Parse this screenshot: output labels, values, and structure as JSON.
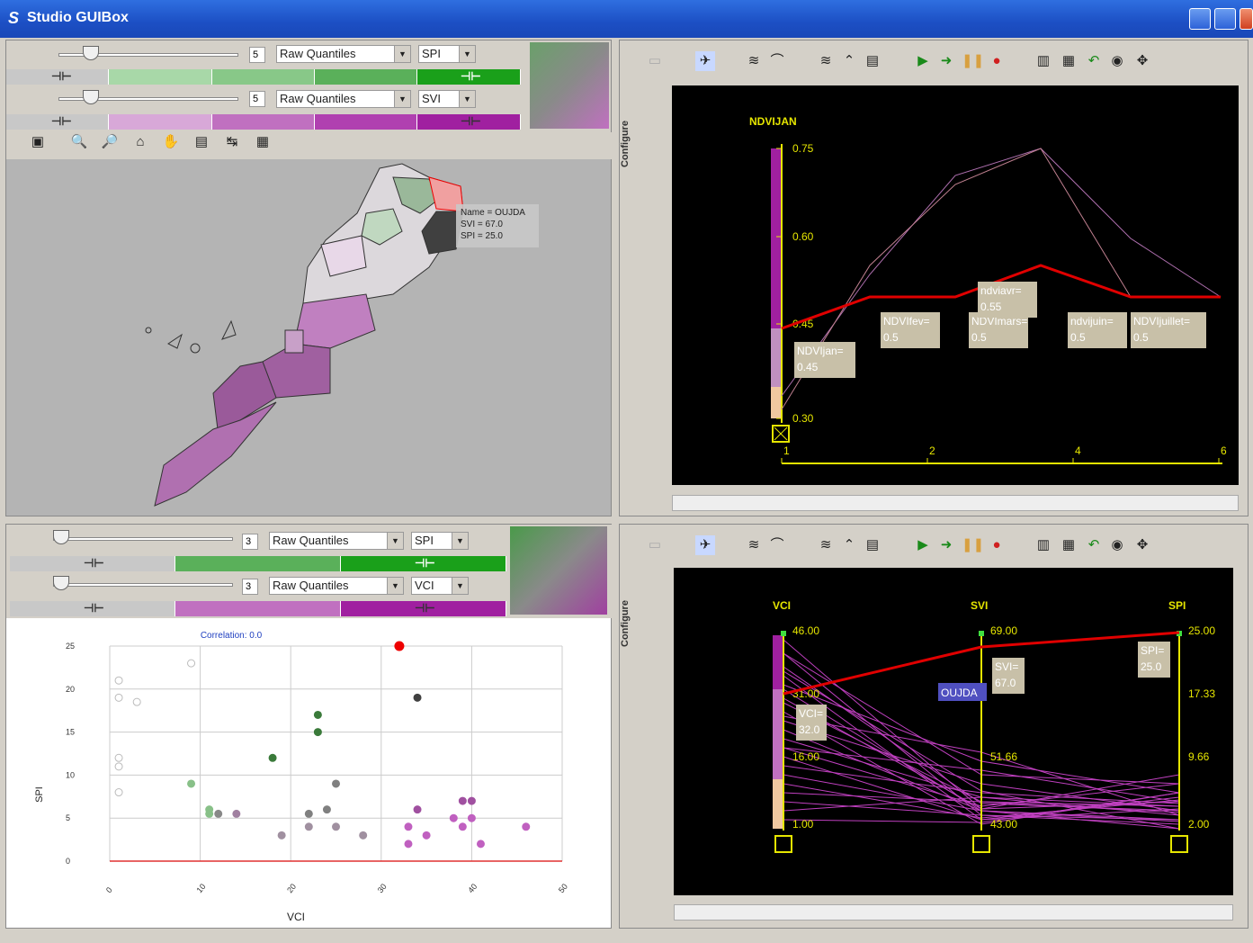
{
  "window": {
    "title": "Studio GUIBox",
    "logo": "S"
  },
  "top_left": {
    "row1": {
      "classes": "5",
      "method": "Raw Quantiles",
      "variable": "SPI"
    },
    "row2": {
      "classes": "5",
      "method": "Raw Quantiles",
      "variable": "SVI"
    },
    "tooltip": {
      "name": "Name = OUJDA",
      "svi": "SVI = 67.0",
      "spi": "SPI = 25.0"
    }
  },
  "bottom_left": {
    "row1": {
      "classes": "3",
      "method": "Raw Quantiles",
      "variable": "SPI"
    },
    "row2": {
      "classes": "3",
      "method": "Raw Quantiles",
      "variable": "VCI"
    },
    "chart_title": "Correlation: 0.0"
  },
  "top_right": {
    "configure": "Configure",
    "axis_title": "NDVIJAN",
    "y_ticks": [
      "0.75",
      "0.60",
      "0.45",
      "0.30"
    ],
    "x_ticks": [
      "1",
      "2",
      "4",
      "6"
    ],
    "labels": [
      {
        "k": "NDVIjan=",
        "v": "0.45"
      },
      {
        "k": "NDVIfev=",
        "v": "0.5"
      },
      {
        "k": "NDVImars=",
        "v": "0.5"
      },
      {
        "k": "ndviavr=",
        "v": "0.55"
      },
      {
        "k": "ndvijuin=",
        "v": "0.5"
      },
      {
        "k": "NDVIjuillet=",
        "v": "0.5"
      }
    ]
  },
  "bottom_right": {
    "configure": "Configure",
    "axes": [
      {
        "name": "VCI",
        "ticks": [
          "46.00",
          "31.00",
          "16.00",
          "1.00"
        ]
      },
      {
        "name": "SVI",
        "ticks": [
          "69.00",
          "51.66",
          "43.00"
        ]
      },
      {
        "name": "SPI",
        "ticks": [
          "25.00",
          "17.33",
          "9.66",
          "2.00"
        ]
      }
    ],
    "labels": {
      "vci": {
        "k": "VCI=",
        "v": "32.0"
      },
      "svi": {
        "k": "SVI=",
        "v": "67.0"
      },
      "spi": {
        "k": "SPI=",
        "v": "25.0"
      },
      "name": "OUJDA"
    }
  },
  "colors": {
    "green": "#1aa01a",
    "purple": "#a020a0",
    "red": "#e00000",
    "yellow": "#e6e600"
  },
  "chart_data": {
    "type": "scatter",
    "title": "Correlation: 0.0",
    "xlabel": "VCI",
    "ylabel": "SPI",
    "xlim": [
      0,
      50
    ],
    "ylim": [
      0,
      25
    ],
    "x_ticks": [
      "0",
      "10",
      "20",
      "30",
      "40",
      "50"
    ],
    "y_ticks": [
      "25",
      "20",
      "15",
      "10",
      "5",
      "0"
    ],
    "points": [
      {
        "x": 1,
        "y": 21,
        "c": "#cccccc",
        "h": true
      },
      {
        "x": 1,
        "y": 19,
        "c": "#cccccc",
        "h": true
      },
      {
        "x": 3,
        "y": 18.5,
        "c": "#cccccc",
        "h": true
      },
      {
        "x": 1,
        "y": 12,
        "c": "#cccccc",
        "h": true
      },
      {
        "x": 1,
        "y": 11,
        "c": "#cccccc",
        "h": true
      },
      {
        "x": 1,
        "y": 8,
        "c": "#cccccc",
        "h": true
      },
      {
        "x": 9,
        "y": 23,
        "c": "#cccccc",
        "h": true
      },
      {
        "x": 9,
        "y": 9,
        "c": "#88c088"
      },
      {
        "x": 11,
        "y": 6,
        "c": "#88c088"
      },
      {
        "x": 11,
        "y": 5.5,
        "c": "#88c088"
      },
      {
        "x": 12,
        "y": 5.5,
        "c": "#888888"
      },
      {
        "x": 14,
        "y": 5.5,
        "c": "#a080a0"
      },
      {
        "x": 18,
        "y": 12,
        "c": "#3a7a3a"
      },
      {
        "x": 23,
        "y": 17,
        "c": "#3a7a3a"
      },
      {
        "x": 23,
        "y": 15,
        "c": "#3a7a3a"
      },
      {
        "x": 19,
        "y": 3,
        "c": "#a090a0"
      },
      {
        "x": 22,
        "y": 5.5,
        "c": "#808080"
      },
      {
        "x": 22,
        "y": 4,
        "c": "#a090a0"
      },
      {
        "x": 24,
        "y": 6,
        "c": "#808080"
      },
      {
        "x": 25,
        "y": 9,
        "c": "#808080"
      },
      {
        "x": 25,
        "y": 4,
        "c": "#a090a0"
      },
      {
        "x": 28,
        "y": 3,
        "c": "#a090a0"
      },
      {
        "x": 32,
        "y": 25,
        "c": "#ee0000"
      },
      {
        "x": 34,
        "y": 19,
        "c": "#404040"
      },
      {
        "x": 34,
        "y": 6,
        "c": "#a050a0"
      },
      {
        "x": 33,
        "y": 4,
        "c": "#c060c0"
      },
      {
        "x": 35,
        "y": 3,
        "c": "#c060c0"
      },
      {
        "x": 33,
        "y": 2,
        "c": "#c060c0"
      },
      {
        "x": 38,
        "y": 5,
        "c": "#c060c0"
      },
      {
        "x": 39,
        "y": 7,
        "c": "#a050a0"
      },
      {
        "x": 40,
        "y": 7,
        "c": "#a050a0"
      },
      {
        "x": 39,
        "y": 4,
        "c": "#c060c0"
      },
      {
        "x": 40,
        "y": 5,
        "c": "#c060c0"
      },
      {
        "x": 41,
        "y": 2,
        "c": "#c060c0"
      },
      {
        "x": 46,
        "y": 4,
        "c": "#c060c0"
      }
    ]
  }
}
